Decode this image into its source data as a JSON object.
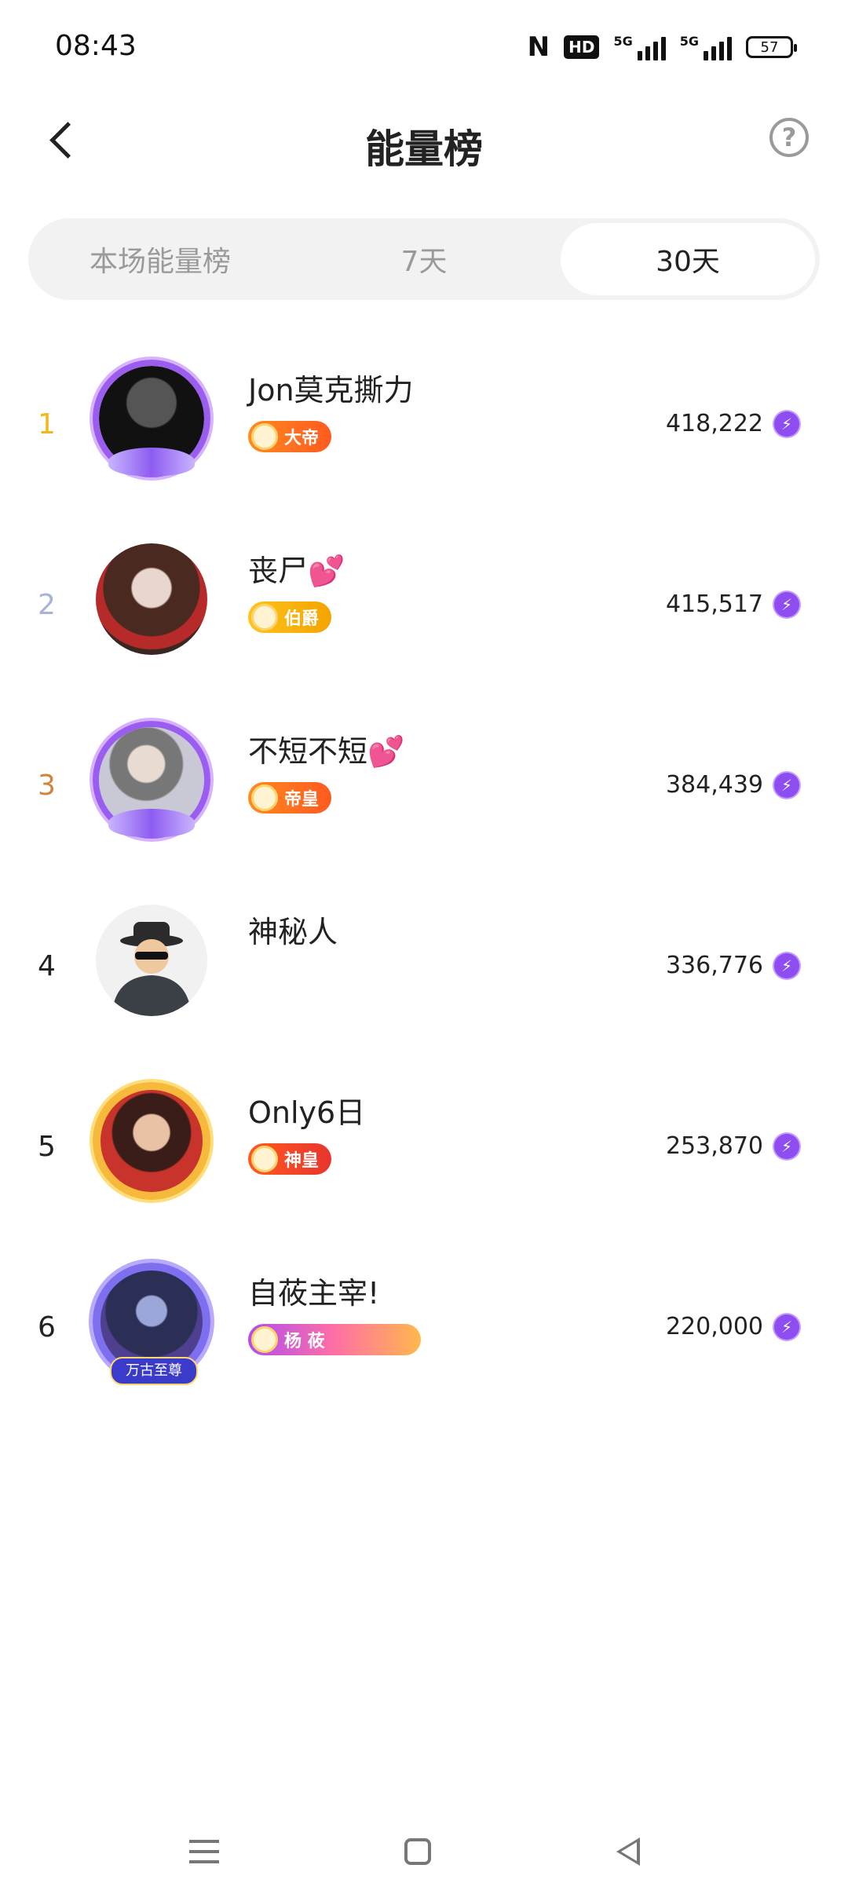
{
  "status_bar": {
    "time": "08:43",
    "nfc": "N",
    "hd": "HD",
    "signal1_label": "5G",
    "signal2_label": "5G",
    "battery": "57"
  },
  "header": {
    "title": "能量榜",
    "help_icon": "question-circle-icon",
    "back_icon": "chevron-left-icon"
  },
  "tabs": [
    {
      "label": "本场能量榜",
      "active": false
    },
    {
      "label": "7天",
      "active": false
    },
    {
      "label": "30天",
      "active": true
    }
  ],
  "ranking": [
    {
      "rank": "1",
      "name": "Jon莫克撕力",
      "badge": "大帝",
      "score": "418,222"
    },
    {
      "rank": "2",
      "name": "丧尸💕",
      "badge": "伯爵",
      "score": "415,517"
    },
    {
      "rank": "3",
      "name": "不短不短💕",
      "badge": "帝皇",
      "score": "384,439"
    },
    {
      "rank": "4",
      "name": "神秘人",
      "badge": "",
      "score": "336,776"
    },
    {
      "rank": "5",
      "name": "Only6日",
      "badge": "神皇",
      "score": "253,870"
    },
    {
      "rank": "6",
      "name": "自莜主宰!",
      "badge": "杨 莜",
      "avatar_frame_label": "万古至尊",
      "score": "220,000"
    }
  ],
  "colors": {
    "rank1": "#f2b51c",
    "rank2": "#a8b3d6",
    "rank3": "#d1833b",
    "energy_bolt": "#8d4df0",
    "active_tab_bg": "#ffffff",
    "tab_track_bg": "#f2f2f2"
  },
  "nav_bar": {
    "menu_icon": "menu-icon",
    "home_icon": "home-square-icon",
    "back_icon": "back-triangle-icon"
  }
}
